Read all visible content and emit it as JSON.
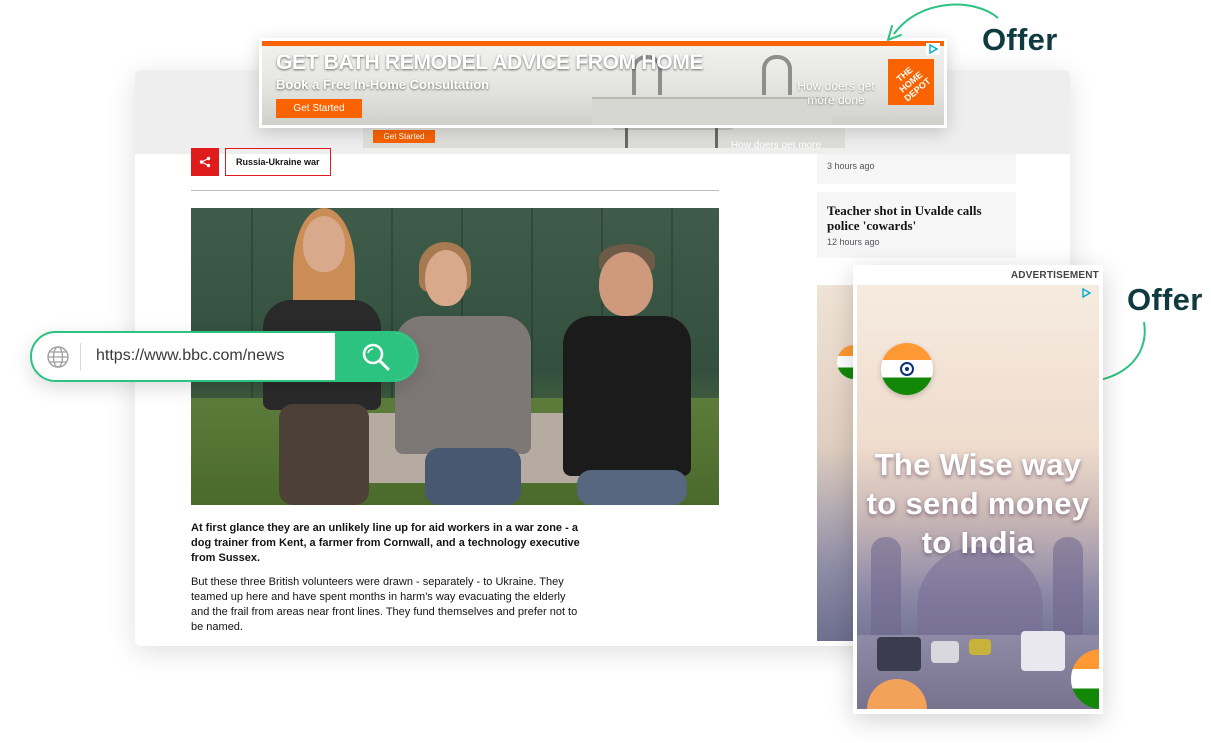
{
  "top_ad": {
    "headline": "GET BATH REMODEL ADVICE FROM HOME",
    "subline": "Book a Free In-Home Consultation",
    "cta": "Get Started",
    "tagline": "How doers get more done",
    "logo": "THE HOME DEPOT",
    "brand_color": "#f96302"
  },
  "callouts": {
    "top": "Offer",
    "right": "Offer",
    "arrow_color": "#2cc27f",
    "text_color": "#0f3a40"
  },
  "article": {
    "topic_tag": "Russia-Ukraine war",
    "lead": "At first glance they are an unlikely line up for aid workers in a war zone - a dog trainer from Kent, a farmer from Cornwall, and a technology executive from Sussex.",
    "body": "But these three British volunteers were drawn - separately - to Ukraine. They teamed up here and have spent months in harm's way evacuating the elderly and the frail from areas near front lines. They fund themselves and prefer not to be named.",
    "accent_color": "#e01b1b"
  },
  "sidebar": {
    "items": [
      {
        "title": "",
        "time": "3 hours ago"
      },
      {
        "title": "Teacher shot in Uvalde calls police 'cowards'",
        "time": "12 hours ago"
      }
    ]
  },
  "url_bar": {
    "url": "https://www.bbc.com/news",
    "accent_color": "#2cc27f"
  },
  "side_ad": {
    "label": "ADVERTISEMENT",
    "copy": "The Wise way to send money to India"
  },
  "icons": {
    "share": "share-icon",
    "globe": "globe-icon",
    "search": "search-icon",
    "adchoices": "adchoices-icon",
    "flag": "india-flag-icon"
  }
}
